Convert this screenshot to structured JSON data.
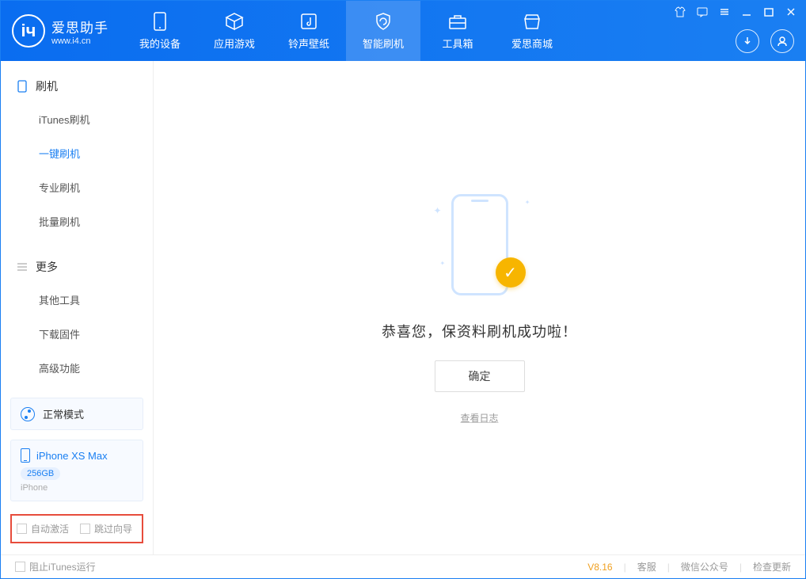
{
  "app": {
    "name": "爱思助手",
    "url": "www.i4.cn"
  },
  "nav": {
    "items": [
      {
        "label": "我的设备"
      },
      {
        "label": "应用游戏"
      },
      {
        "label": "铃声壁纸"
      },
      {
        "label": "智能刷机",
        "active": true
      },
      {
        "label": "工具箱"
      },
      {
        "label": "爱思商城"
      }
    ]
  },
  "sidebar": {
    "section1": {
      "title": "刷机",
      "items": [
        {
          "label": "iTunes刷机"
        },
        {
          "label": "一键刷机",
          "active": true
        },
        {
          "label": "专业刷机"
        },
        {
          "label": "批量刷机"
        }
      ]
    },
    "section2": {
      "title": "更多",
      "items": [
        {
          "label": "其他工具"
        },
        {
          "label": "下载固件"
        },
        {
          "label": "高级功能"
        }
      ]
    },
    "mode": {
      "label": "正常模式"
    },
    "device": {
      "name": "iPhone XS Max",
      "storage": "256GB",
      "type": "iPhone"
    },
    "checks": {
      "auto_activate": "自动激活",
      "skip_guide": "跳过向导"
    }
  },
  "main": {
    "message": "恭喜您，保资料刷机成功啦！",
    "ok": "确定",
    "view_log": "查看日志"
  },
  "footer": {
    "block_itunes": "阻止iTunes运行",
    "version": "V8.16",
    "links": {
      "service": "客服",
      "wechat": "微信公众号",
      "update": "检查更新"
    }
  }
}
